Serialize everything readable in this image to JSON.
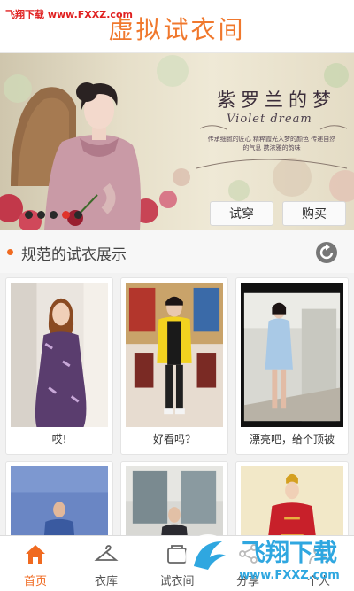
{
  "watermark_top": "飞翔下载 www.FXXZ.com",
  "header": {
    "title": "虚拟试衣间"
  },
  "banner": {
    "title": "紫罗兰的梦",
    "subtitle": "Violet dream",
    "description": "传承细腻的匠心 精粹霞光入梦的颜色 传递自然的气息 携浓雅的韵味",
    "slide_count": 5,
    "active_slide": 4,
    "try_on_label": "试穿",
    "buy_label": "购买"
  },
  "section": {
    "title": "规范的试衣展示"
  },
  "gallery": [
    {
      "caption": "哎!"
    },
    {
      "caption": "好看吗？"
    },
    {
      "caption": "漂亮吧，给个顶被"
    },
    {
      "caption": ""
    },
    {
      "caption": ""
    },
    {
      "caption": ""
    }
  ],
  "tabs": [
    {
      "label": "首页",
      "icon": "home-icon",
      "active": true
    },
    {
      "label": "衣库",
      "icon": "hanger-icon",
      "active": false
    },
    {
      "label": "试衣间",
      "icon": "fitting-room-icon",
      "active": false
    },
    {
      "label": "分享",
      "icon": "share-icon",
      "active": false
    },
    {
      "label": "个人",
      "icon": "profile-icon",
      "active": false
    }
  ],
  "watermark_bottom": {
    "main": "飞翔下载",
    "site": "www.FXXZ.com"
  },
  "colors": {
    "accent": "#f06a20",
    "title": "#f0782d",
    "watermark": "#2fa7e0"
  }
}
